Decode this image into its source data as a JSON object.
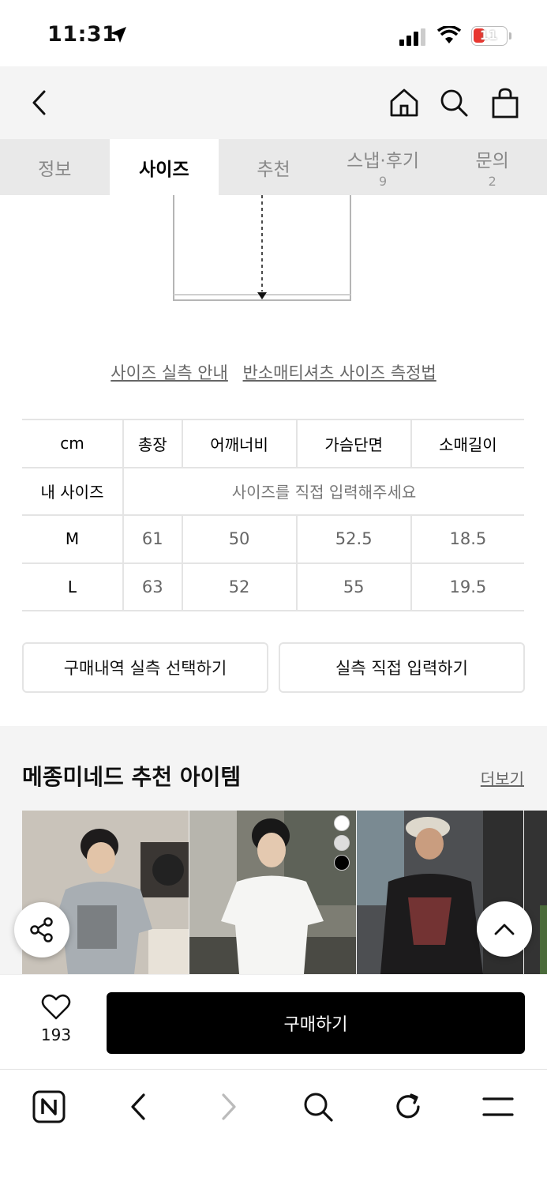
{
  "status_bar": {
    "time": "11:31",
    "battery": "11"
  },
  "header": {
    "back_icon": "chevron-left-icon",
    "home_icon": "home-icon",
    "search_icon": "search-icon",
    "cart_icon": "shopping-bag-icon"
  },
  "tabs": [
    {
      "label": "정보",
      "count": ""
    },
    {
      "label": "사이즈",
      "count": ""
    },
    {
      "label": "추천",
      "count": ""
    },
    {
      "label": "스냅·후기",
      "count": "9"
    },
    {
      "label": "문의",
      "count": "2"
    }
  ],
  "size_links": {
    "guide": "사이즈 실측 안내",
    "method": "반소매티셔츠 사이즈 측정법"
  },
  "size_table": {
    "unit": "cm",
    "headers": [
      "총장",
      "어깨너비",
      "가슴단면",
      "소매길이"
    ],
    "my_size_label": "내 사이즈",
    "my_size_hint": "사이즈를 직접 입력해주세요",
    "rows": [
      {
        "size": "M",
        "values": [
          "61",
          "50",
          "52.5",
          "18.5"
        ]
      },
      {
        "size": "L",
        "values": [
          "63",
          "52",
          "55",
          "19.5"
        ]
      }
    ]
  },
  "buttons": {
    "select_purchase": "구매내역 실측 선택하기",
    "enter_direct": "실측 직접 입력하기"
  },
  "recommend": {
    "title": "메종미네드 추천 아이템",
    "more": "더보기"
  },
  "purchase": {
    "like_count": "193",
    "buy_label": "구매하기"
  },
  "colors": {
    "accent": "#000000",
    "tab_bg": "#e9e9e9",
    "section_bg": "#f4f4f4"
  }
}
